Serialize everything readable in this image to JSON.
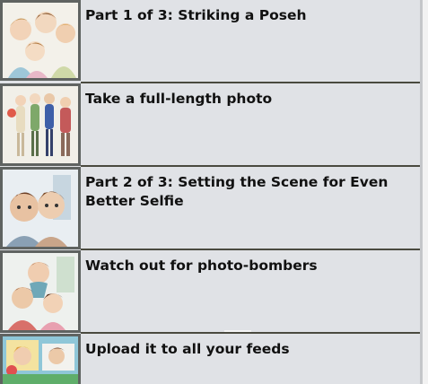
{
  "list": {
    "items": [
      {
        "title": "Part 1 of 3: Striking a Poseh",
        "thumb_icon": "group-of-friends-illustration"
      },
      {
        "title": "Take a full-length photo",
        "thumb_icon": "people-standing-full-length-illustration"
      },
      {
        "title": "Part 2 of 3: Setting the Scene for Even Better Selfie",
        "thumb_icon": "couple-close-up-illustration"
      },
      {
        "title": "Watch out for photo-bombers",
        "thumb_icon": "photo-bomber-illustration"
      },
      {
        "title": "Upload it to all your feeds",
        "thumb_icon": "social-feed-illustration"
      }
    ]
  },
  "colors": {
    "background": "#e0e2e6",
    "thumb_frame": "#5f6361",
    "divider": "#4a4a3f",
    "text": "#111111"
  }
}
